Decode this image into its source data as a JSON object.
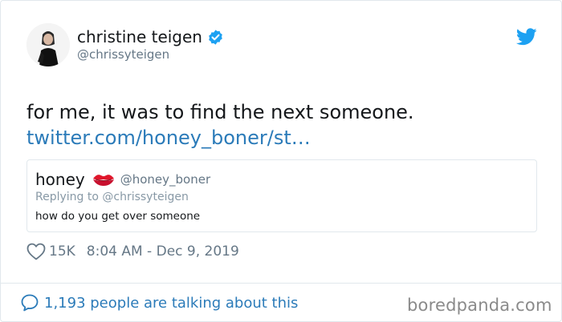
{
  "author": {
    "display_name": "christine teigen",
    "handle": "@chrissyteigen"
  },
  "tweet": {
    "text": "for me, it was to find the next someone.",
    "link_text": "twitter.com/honey_boner/st…"
  },
  "quoted_tweet": {
    "display_name": "honey",
    "handle": "@honey_boner",
    "replying_to": "Replying to @chrissyteigen",
    "text": "how do you get over someone"
  },
  "meta": {
    "likes": "15K",
    "timestamp": "8:04 AM - Dec 9, 2019"
  },
  "footer": {
    "conversation_text": "1,193 people are talking about this",
    "watermark": "boredpanda.com"
  },
  "icons": {
    "verified": "verified-badge-icon",
    "brand": "twitter-bird-icon",
    "like": "heart-icon",
    "reply": "speech-bubble-icon",
    "emoji": "kiss-mark-icon"
  },
  "colors": {
    "link": "#2b7bb9",
    "verified": "#1da1f2",
    "muted": "#657786",
    "border": "#e1e8ed"
  }
}
